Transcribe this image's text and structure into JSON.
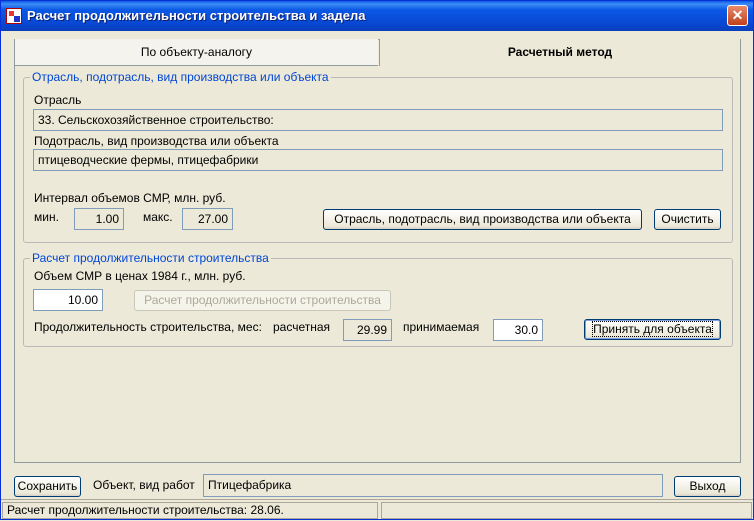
{
  "window": {
    "title": "Расчет продолжительности строительства и задела",
    "close_symbol": "✕"
  },
  "tabs": [
    {
      "label": "По объекту-аналогу",
      "active": false
    },
    {
      "label": "Расчетный метод",
      "active": true
    }
  ],
  "industry_group": {
    "title": "Отрасль, подотрасль, вид производства или объекта",
    "industry_label": "Отрасль",
    "industry_value": "33. Сельскохозяйственное строительство:",
    "subindustry_label": "Подотрасль, вид производства или объекта",
    "subindustry_value": "птицеводческие фермы, птицефабрики",
    "interval_label": "Интервал объемов СМР, млн. руб.",
    "min_label": "мин.",
    "min_value": "1.00",
    "max_label": "макс.",
    "max_value": "27.00",
    "select_button": "Отрасль, подотрасль, вид производства или объекта",
    "clear_button": "Очистить"
  },
  "calc_group": {
    "title": "Расчет продолжительности строительства",
    "volume_label": "Объем СМР в ценах 1984 г., млн. руб.",
    "volume_value": "10.00",
    "calc_button": "Расчет продолжительности строительства",
    "duration_label": "Продолжительность строительства, мес:",
    "calculated_label": "расчетная",
    "calculated_value": "29.99",
    "accepted_label": "принимаемая",
    "accepted_value": "30.0",
    "accept_button": "Принять для объекта"
  },
  "footer": {
    "save_button": "Сохранить",
    "object_label": "Объект, вид работ",
    "object_value": "Птицефабрика",
    "exit_button": "Выход"
  },
  "status": {
    "left_text": "Расчет продолжительности строительства:  28.06.",
    "right_text": ""
  },
  "colors": {
    "titlebar": "#0a58e4",
    "group_title": "#0046d5",
    "window_bg": "#ece9d8"
  }
}
